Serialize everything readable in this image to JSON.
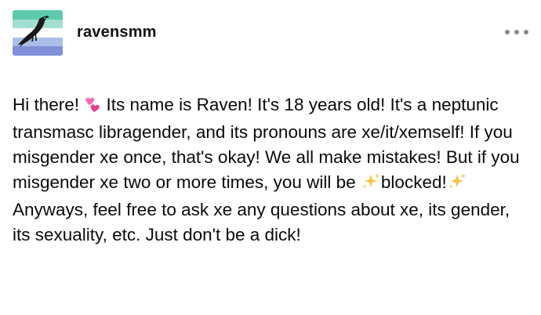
{
  "post": {
    "username": "ravensmm",
    "more_menu_icon": "ellipsis-icon",
    "avatar_icon": "raven-avatar-icon",
    "avatar_stripe_colors": [
      "#5ec9ad",
      "#a3dfd0",
      "#ffffff",
      "#a9bfe8",
      "#7f8fd8"
    ],
    "body": {
      "part1": "Hi there! ",
      "emoji_heart": "two-hearts-icon",
      "part2": " Its name is Raven! It's 18 years old! It's a neptunic transmasc libragender, and its pronouns are xe/it/xemself! If you misgender xe once, that's okay! We all make mistakes! But if you misgender xe two or more times, you will be ",
      "emoji_sparkles": "sparkles-icon",
      "part3": "blocked!",
      "part4": " Anyways, feel free to ask xe any questions about xe, its gender, its sexuality, etc. Just don't be a dick!"
    }
  }
}
